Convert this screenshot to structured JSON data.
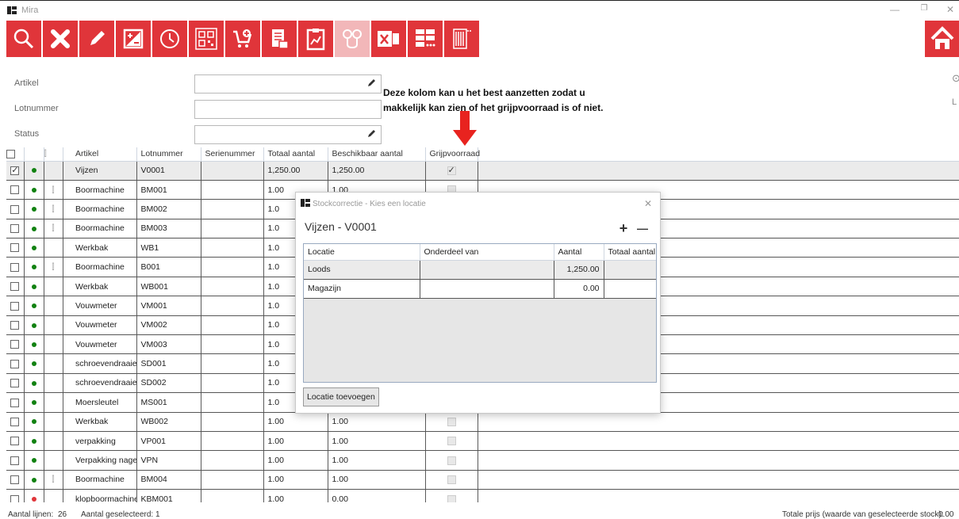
{
  "app": {
    "title": "Mira"
  },
  "window_controls": {
    "minimize": "—",
    "restore": "❐",
    "close": "✕"
  },
  "toolbar": {
    "buttons": [
      {
        "icon": "search-icon"
      },
      {
        "icon": "delete-icon"
      },
      {
        "icon": "edit-icon"
      },
      {
        "icon": "plus-minus-icon"
      },
      {
        "icon": "history-icon"
      },
      {
        "icon": "qr-code-icon"
      },
      {
        "icon": "add-to-cart-icon"
      },
      {
        "icon": "stock-document-icon"
      },
      {
        "icon": "clipboard-chart-icon"
      },
      {
        "icon": "locations-icon",
        "disabled": true
      },
      {
        "icon": "excel-icon"
      },
      {
        "icon": "column-settings-icon"
      },
      {
        "icon": "barcode-print-icon"
      }
    ],
    "home_icon": "home-icon",
    "accent_color": "#e0353a"
  },
  "filters": {
    "artikel_label": "Artikel",
    "lotnummer_label": "Lotnummer",
    "status_label": "Status"
  },
  "annotation": {
    "line1": "Deze kolom kan u het best aanzetten zodat u",
    "line2": "makkelijk kan zien of het grijpvoorraad is of niet."
  },
  "table": {
    "headers": {
      "artikel": "Artikel",
      "lotnummer": "Lotnummer",
      "serienummer": "Serienummer",
      "totaal": "Totaal aantal",
      "beschikbaar": "Beschikbaar aantal",
      "grijp": "Grijpvoorraad"
    },
    "rows": [
      {
        "checked": true,
        "status": "green",
        "attachment": false,
        "artikel": "Vijzen",
        "lot": "V0001",
        "serie": "",
        "totaal": "1,250.00",
        "beschikbaar": "1,250.00",
        "grijp": true
      },
      {
        "checked": false,
        "status": "green",
        "attachment": true,
        "artikel": "Boormachine",
        "lot": "BM001",
        "serie": "",
        "totaal": "1.00",
        "beschikbaar": "1.00",
        "grijp": false
      },
      {
        "checked": false,
        "status": "green",
        "attachment": true,
        "artikel": "Boormachine",
        "lot": "BM002",
        "serie": "",
        "totaal": "1.0",
        "beschikbaar": "",
        "grijp": false
      },
      {
        "checked": false,
        "status": "green",
        "attachment": true,
        "artikel": "Boormachine",
        "lot": "BM003",
        "serie": "",
        "totaal": "1.0",
        "beschikbaar": "",
        "grijp": false
      },
      {
        "checked": false,
        "status": "green",
        "attachment": false,
        "artikel": "Werkbak",
        "lot": "WB1",
        "serie": "",
        "totaal": "1.0",
        "beschikbaar": "",
        "grijp": false
      },
      {
        "checked": false,
        "status": "green",
        "attachment": true,
        "artikel": "Boormachine",
        "lot": "B001",
        "serie": "",
        "totaal": "1.0",
        "beschikbaar": "",
        "grijp": false
      },
      {
        "checked": false,
        "status": "green",
        "attachment": false,
        "artikel": "Werkbak",
        "lot": "WB001",
        "serie": "",
        "totaal": "1.0",
        "beschikbaar": "",
        "grijp": false
      },
      {
        "checked": false,
        "status": "green",
        "attachment": false,
        "artikel": "Vouwmeter",
        "lot": "VM001",
        "serie": "",
        "totaal": "1.0",
        "beschikbaar": "",
        "grijp": false
      },
      {
        "checked": false,
        "status": "green",
        "attachment": false,
        "artikel": "Vouwmeter",
        "lot": "VM002",
        "serie": "",
        "totaal": "1.0",
        "beschikbaar": "",
        "grijp": false
      },
      {
        "checked": false,
        "status": "green",
        "attachment": false,
        "artikel": "Vouwmeter",
        "lot": "VM003",
        "serie": "",
        "totaal": "1.0",
        "beschikbaar": "",
        "grijp": false
      },
      {
        "checked": false,
        "status": "green",
        "attachment": false,
        "artikel": "schroevendraaier",
        "lot": "SD001",
        "serie": "",
        "totaal": "1.0",
        "beschikbaar": "",
        "grijp": false
      },
      {
        "checked": false,
        "status": "green",
        "attachment": false,
        "artikel": "schroevendraaier",
        "lot": "SD002",
        "serie": "",
        "totaal": "1.0",
        "beschikbaar": "",
        "grijp": false
      },
      {
        "checked": false,
        "status": "green",
        "attachment": false,
        "artikel": "Moersleutel",
        "lot": "MS001",
        "serie": "",
        "totaal": "1.0",
        "beschikbaar": "",
        "grijp": false
      },
      {
        "checked": false,
        "status": "green",
        "attachment": false,
        "artikel": "Werkbak",
        "lot": "WB002",
        "serie": "",
        "totaal": "1.00",
        "beschikbaar": "1.00",
        "grijp": false
      },
      {
        "checked": false,
        "status": "green",
        "attachment": false,
        "artikel": "verpakking",
        "lot": "VP001",
        "serie": "",
        "totaal": "1.00",
        "beschikbaar": "1.00",
        "grijp": false
      },
      {
        "checked": false,
        "status": "green",
        "attachment": false,
        "artikel": "Verpakking nagels",
        "lot": "VPN",
        "serie": "",
        "totaal": "1.00",
        "beschikbaar": "1.00",
        "grijp": false
      },
      {
        "checked": false,
        "status": "green",
        "attachment": true,
        "artikel": "Boormachine",
        "lot": "BM004",
        "serie": "",
        "totaal": "1.00",
        "beschikbaar": "1.00",
        "grijp": false
      },
      {
        "checked": false,
        "status": "red",
        "attachment": false,
        "artikel": "klopboormachine",
        "lot": "KBM001",
        "serie": "",
        "totaal": "1.00",
        "beschikbaar": "0.00",
        "grijp": false
      }
    ]
  },
  "statusbar": {
    "lines_label": "Aantal lijnen:",
    "lines_value": "26",
    "selected_label": "Aantal geselecteerd:",
    "selected_value": "1",
    "total_label": "Totale prijs (waarde van geselecteerde stock):",
    "total_value": "0.00"
  },
  "dialog": {
    "title": "Stockcorrectie - Kies een locatie",
    "heading": "Vijzen - V0001",
    "plus": "+",
    "minus": "—",
    "headers": {
      "locatie": "Locatie",
      "onderdeel": "Onderdeel van",
      "aantal": "Aantal",
      "totaal": "Totaal aantal"
    },
    "rows": [
      {
        "locatie": "Loods",
        "onderdeel": "",
        "aantal": "1,250.00",
        "totaal": ""
      },
      {
        "locatie": "Magazijn",
        "onderdeel": "",
        "aantal": "0.00",
        "totaal": ""
      }
    ],
    "add_button": "Locatie toevoegen"
  }
}
